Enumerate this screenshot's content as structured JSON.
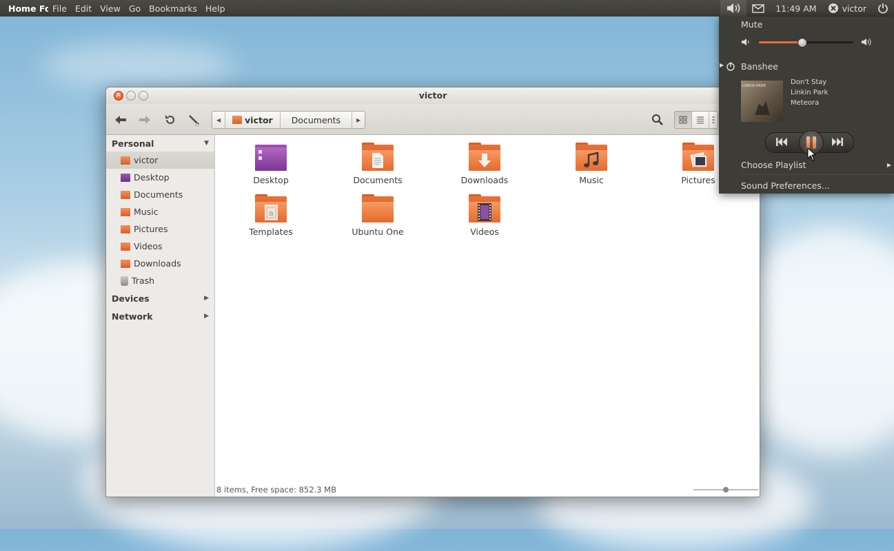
{
  "panel": {
    "app_title": "Home Fo",
    "menus": [
      "File",
      "Edit",
      "View",
      "Go",
      "Bookmarks",
      "Help"
    ],
    "clock": "11:49 AM",
    "user": "victor"
  },
  "window": {
    "title": "victor",
    "breadcrumb": [
      "victor",
      "Documents"
    ]
  },
  "sidebar": {
    "personal_label": "Personal",
    "items": [
      {
        "label": "victor",
        "icon": "home-folder-icon"
      },
      {
        "label": "Desktop",
        "icon": "desktop-folder-icon"
      },
      {
        "label": "Documents",
        "icon": "documents-folder-icon"
      },
      {
        "label": "Music",
        "icon": "music-folder-icon"
      },
      {
        "label": "Pictures",
        "icon": "pictures-folder-icon"
      },
      {
        "label": "Videos",
        "icon": "videos-folder-icon"
      },
      {
        "label": "Downloads",
        "icon": "downloads-folder-icon"
      },
      {
        "label": "Trash",
        "icon": "trash-icon"
      }
    ],
    "devices_label": "Devices",
    "network_label": "Network"
  },
  "files": [
    {
      "label": "Desktop"
    },
    {
      "label": "Documents"
    },
    {
      "label": "Downloads"
    },
    {
      "label": "Music"
    },
    {
      "label": "Pictures"
    },
    {
      "label": "Templates"
    },
    {
      "label": "Ubuntu One"
    },
    {
      "label": "Videos"
    }
  ],
  "status": {
    "text": "8 items, Free space: 852.3 MB",
    "zoom_level": 0.5
  },
  "sound_menu": {
    "mute_label": "Mute",
    "volume": 0.45,
    "player_name": "Banshee",
    "track": {
      "title": "Don't Stay",
      "artist": "Linkin Park",
      "album": "Meteora"
    },
    "album_art_text": "LINKIN PARK",
    "choose_playlist_label": "Choose Playlist",
    "preferences_label": "Sound Preferences..."
  },
  "colors": {
    "accent": "#e4703b",
    "panel_bg": "#3c3b37",
    "folder_orange": "#e56a2e"
  }
}
